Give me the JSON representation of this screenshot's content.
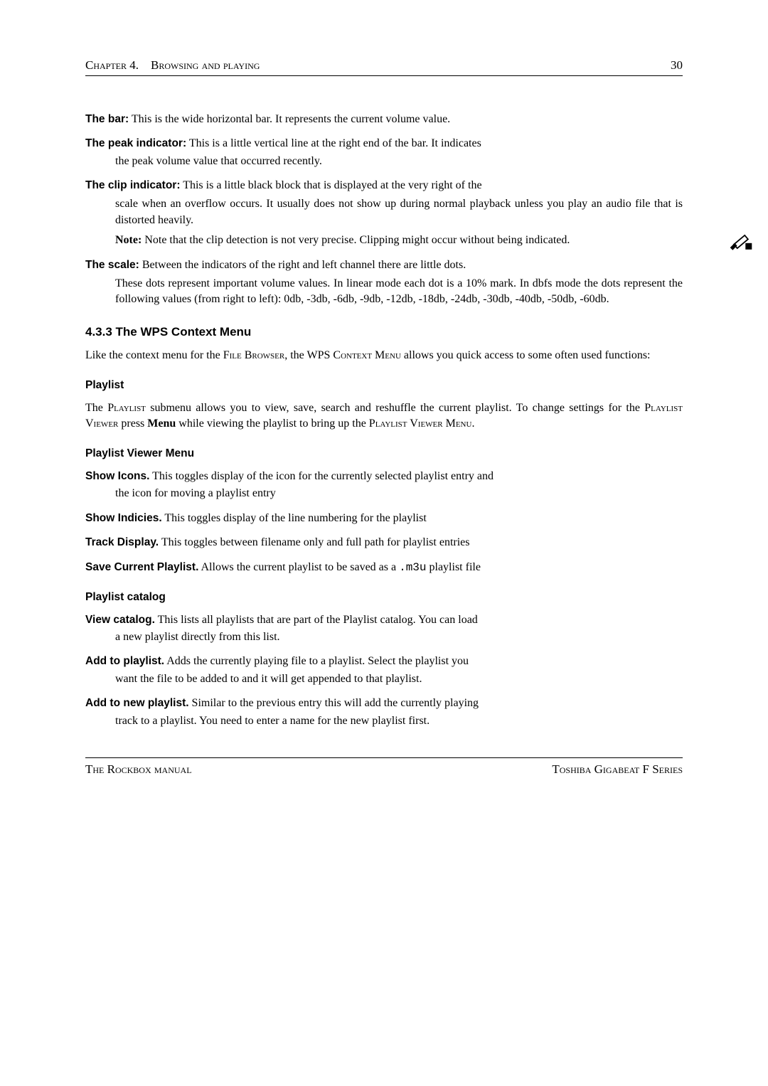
{
  "header": {
    "left": "Chapter 4. Browsing and playing",
    "right": "30"
  },
  "items": {
    "bar": {
      "term": "The bar:",
      "desc": "This is the wide horizontal bar. It represents the current volume value."
    },
    "peak": {
      "term": "The peak indicator:",
      "desc_line1": "This is a little vertical line at the right end of the bar. It indicates",
      "desc_rest": "the peak volume value that occurred recently."
    },
    "clip": {
      "term": "The clip indicator:",
      "desc_line1": "This is a little black block that is displayed at the very right of the",
      "desc_rest": "scale when an overflow occurs. It usually does not show up during normal playback unless you play an audio file that is distorted heavily.",
      "note_label": "Note:",
      "note_text": "Note that the clip detection is not very precise. Clipping might occur without being indicated."
    },
    "scale": {
      "term": "The scale:",
      "desc_line1": "Between the indicators of the right and left channel there are little dots.",
      "desc_rest": "These dots represent important volume values. In linear mode each dot is a 10% mark. In dbfs mode the dots represent the following values (from right to left): 0db, -3db, -6db, -9db, -12db, -18db, -24db, -30db, -40db, -50db, -60db."
    }
  },
  "section": {
    "title": "4.3.3 The WPS Context Menu",
    "para_a": "Like the context menu for the ",
    "sc_filebrowser": "File Browser",
    "para_b": ", the WPS ",
    "sc_context": "Context Menu",
    "para_c": " allows you quick access to some often used functions:"
  },
  "playlist": {
    "title": "Playlist",
    "para_a": "The ",
    "sc_playlist": "Playlist",
    "para_b": " submenu allows you to view, save, search and reshuffle the current playlist. To change settings for the ",
    "sc_viewer": "Playlist Viewer",
    "para_c": " press ",
    "bold_menu": "Menu",
    "para_d": " while viewing the playlist to bring up the ",
    "sc_viewermenu": "Playlist Viewer Menu",
    "para_e": "."
  },
  "viewermenu": {
    "title": "Playlist Viewer Menu",
    "showicons": {
      "term": "Show Icons.",
      "desc_line1": "This toggles display of the icon for the currently selected playlist entry and",
      "desc_rest": "the icon for moving a playlist entry"
    },
    "showindicies": {
      "term": "Show Indicies.",
      "desc": "This toggles display of the line numbering for the playlist"
    },
    "trackdisplay": {
      "term": "Track Display.",
      "desc": "This toggles between filename only and full path for playlist entries"
    },
    "savecurrent": {
      "term": "Save Current Playlist.",
      "desc_a": "Allows the current playlist to be saved as a ",
      "tt": ".m3u",
      "desc_b": " playlist file"
    }
  },
  "catalog": {
    "title": "Playlist catalog",
    "viewcatalog": {
      "term": "View catalog.",
      "desc_line1": "This lists all playlists that are part of the Playlist catalog. You can load",
      "desc_rest": "a new playlist directly from this list."
    },
    "addtoplaylist": {
      "term": "Add to playlist.",
      "desc_line1": "Adds the currently playing file to a playlist. Select the playlist you",
      "desc_rest": "want the file to be added to and it will get appended to that playlist."
    },
    "addtonew": {
      "term": "Add to new playlist.",
      "desc_line1": "Similar to the previous entry this will add the currently playing",
      "desc_rest": "track to a playlist. You need to enter a name for the new playlist first."
    }
  },
  "footer": {
    "left": "The Rockbox manual",
    "right": "Toshiba Gigabeat F Series"
  }
}
